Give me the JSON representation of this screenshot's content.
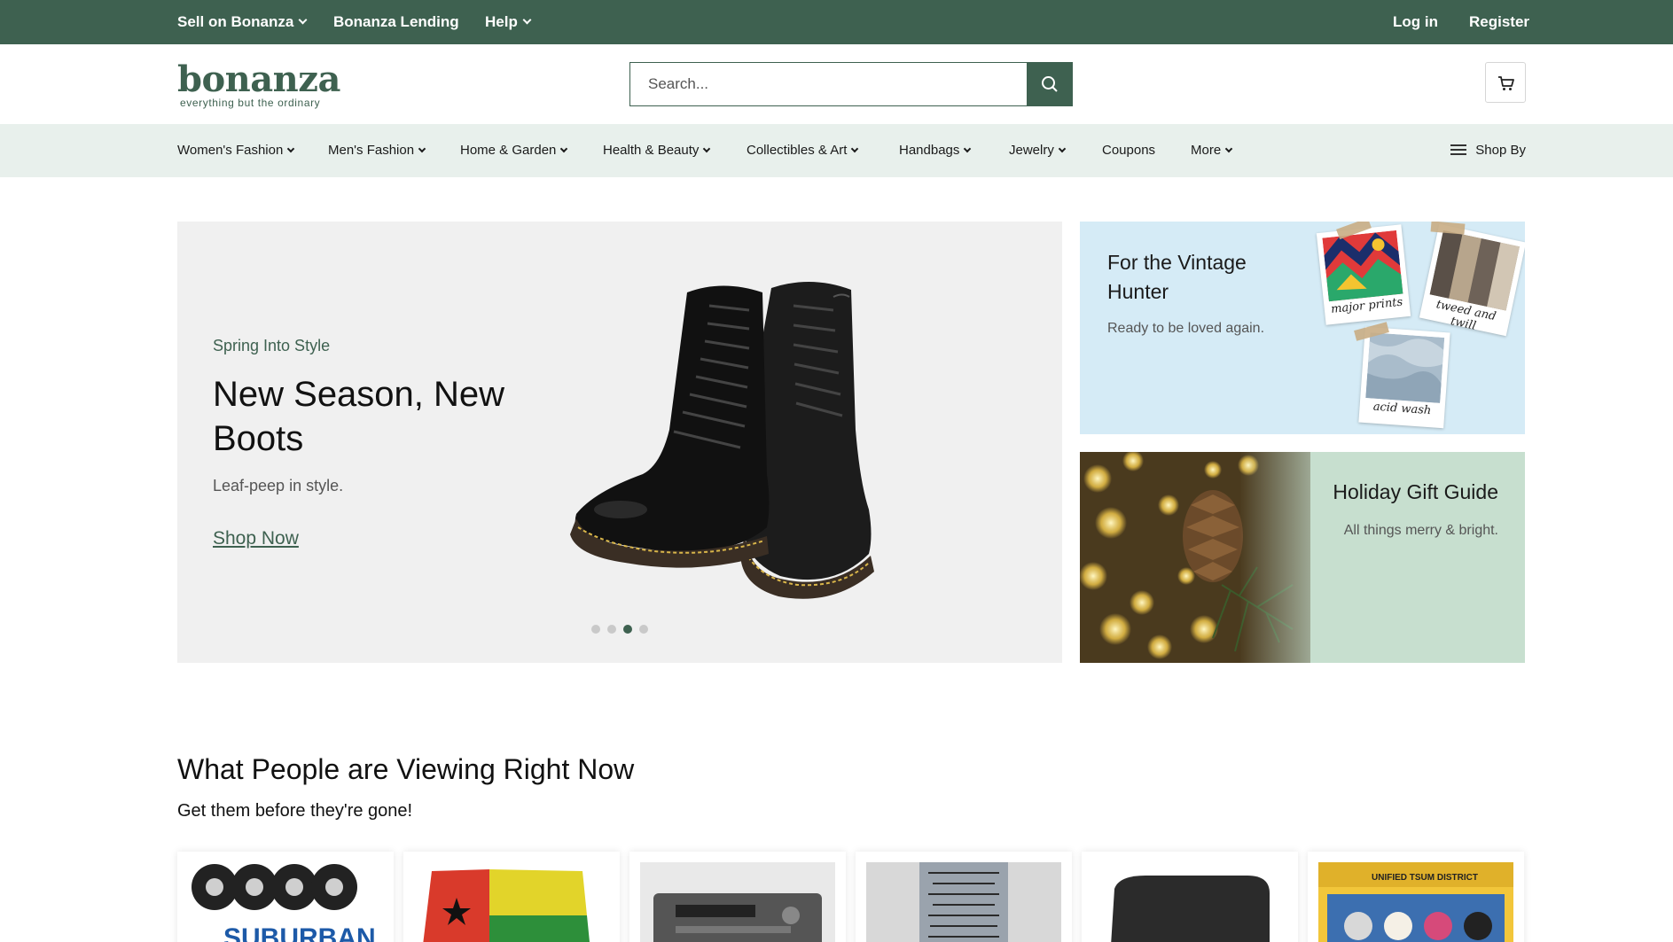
{
  "topbar": {
    "sell": "Sell on Bonanza",
    "lending": "Bonanza Lending",
    "help": "Help",
    "login": "Log in",
    "register": "Register"
  },
  "header": {
    "logo_word": "bonanza",
    "logo_tagline": "everything but the ordinary",
    "search_placeholder": "Search..."
  },
  "nav": {
    "items": [
      "Women's Fashion",
      "Men's Fashion",
      "Home & Garden",
      "Health & Beauty",
      "Collectibles & Art",
      "Handbags",
      "Jewelry",
      "Coupons",
      "More"
    ],
    "shop_by": "Shop By"
  },
  "hero": {
    "kicker": "Spring Into Style",
    "title": "New Season, New Boots",
    "subtitle": "Leaf-peep in style.",
    "link": "Shop Now",
    "slides": 4,
    "active_slide": 3
  },
  "vintage_card": {
    "title": "For the Vintage Hunter",
    "subtitle": "Ready to be loved again.",
    "polaroids": [
      "major prints",
      "tweed and twill",
      "acid wash"
    ]
  },
  "holiday_card": {
    "title": "Holiday Gift Guide",
    "subtitle": "All things merry & bright."
  },
  "section": {
    "title": "What People are Viewing Right Now",
    "subtitle": "Get them before they're gone!"
  },
  "products": [
    {
      "name": "hubcaps-product",
      "logo_text": "SUBURBAN"
    },
    {
      "name": "flag-product"
    },
    {
      "name": "car-radio-product"
    },
    {
      "name": "engraved-plaque-product"
    },
    {
      "name": "black-case-product"
    },
    {
      "name": "tsum-tsum-product",
      "box_text": "UNIFIED TSUM DISTRICT"
    }
  ],
  "colors": {
    "brand_green": "#3e6150",
    "nav_bg": "#e8f0ec",
    "hero_bg": "#f0f0f0",
    "vintage_bg": "#d5ebf6",
    "holiday_bg": "#c7dfcf"
  }
}
